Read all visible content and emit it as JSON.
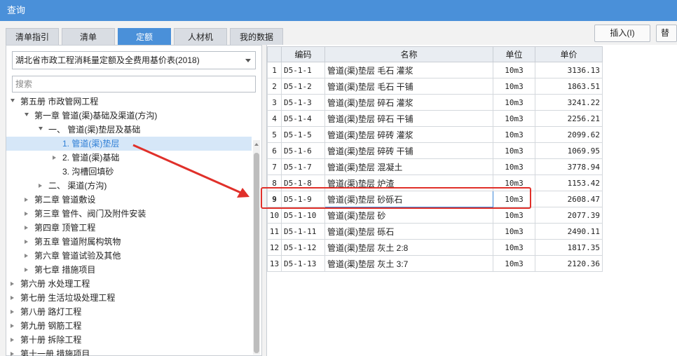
{
  "window": {
    "title": "查询"
  },
  "tabs": [
    {
      "label": "清单指引"
    },
    {
      "label": "清单"
    },
    {
      "label": "定额"
    },
    {
      "label": "人材机"
    },
    {
      "label": "我的数据"
    }
  ],
  "active_tab": "定额",
  "toolbar": {
    "insert_label": "插入(I)",
    "replace_label": "替"
  },
  "library": {
    "selected": "湖北省市政工程消耗量定额及全费用基价表(2018)"
  },
  "search": {
    "placeholder": "搜索"
  },
  "tree": [
    {
      "label": "第五册 市政管网工程",
      "state": "expanded"
    },
    {
      "label": "第一章 管道(渠)基础及渠道(方沟)",
      "state": "expanded"
    },
    {
      "label": "一、 管道(渠)垫层及基础",
      "state": "expanded"
    },
    {
      "label": "1. 管道(渠)垫层",
      "state": "leaf",
      "selected": true
    },
    {
      "label": "2. 管道(渠)基础",
      "state": "collapsed"
    },
    {
      "label": "3. 沟槽回填砂",
      "state": "leaf"
    },
    {
      "label": "二、 渠道(方沟)",
      "state": "collapsed"
    },
    {
      "label": "第二章 管道敷设",
      "state": "collapsed"
    },
    {
      "label": "第三章 管件、阀门及附件安装",
      "state": "collapsed"
    },
    {
      "label": "第四章 顶管工程",
      "state": "collapsed"
    },
    {
      "label": "第五章 管道附属构筑物",
      "state": "collapsed"
    },
    {
      "label": "第六章 管道试验及其他",
      "state": "collapsed"
    },
    {
      "label": "第七章 措施项目",
      "state": "collapsed"
    },
    {
      "label": "第六册 水处理工程",
      "state": "collapsed"
    },
    {
      "label": "第七册 生活垃圾处理工程",
      "state": "collapsed"
    },
    {
      "label": "第八册 路灯工程",
      "state": "collapsed"
    },
    {
      "label": "第九册 钢筋工程",
      "state": "collapsed"
    },
    {
      "label": "第十册 拆除工程",
      "state": "collapsed"
    },
    {
      "label": "第十一册 措施项目",
      "state": "collapsed"
    }
  ],
  "table": {
    "columns": [
      "编码",
      "名称",
      "单位",
      "单价"
    ],
    "rows": [
      {
        "idx": "1",
        "code": "D5-1-1",
        "name": "管道(渠)垫层 毛石 灌浆",
        "unit": "10m3",
        "price": "3136.13"
      },
      {
        "idx": "2",
        "code": "D5-1-2",
        "name": "管道(渠)垫层 毛石 干铺",
        "unit": "10m3",
        "price": "1863.51"
      },
      {
        "idx": "3",
        "code": "D5-1-3",
        "name": "管道(渠)垫层 碎石 灌浆",
        "unit": "10m3",
        "price": "3241.22"
      },
      {
        "idx": "4",
        "code": "D5-1-4",
        "name": "管道(渠)垫层 碎石 干铺",
        "unit": "10m3",
        "price": "2256.21"
      },
      {
        "idx": "5",
        "code": "D5-1-5",
        "name": "管道(渠)垫层 碎砖 灌浆",
        "unit": "10m3",
        "price": "2099.62"
      },
      {
        "idx": "6",
        "code": "D5-1-6",
        "name": "管道(渠)垫层 碎砖 干铺",
        "unit": "10m3",
        "price": "1069.95"
      },
      {
        "idx": "7",
        "code": "D5-1-7",
        "name": "管道(渠)垫层 混凝土",
        "unit": "10m3",
        "price": "3778.94"
      },
      {
        "idx": "8",
        "code": "D5-1-8",
        "name": "管道(渠)垫层 炉渣",
        "unit": "10m3",
        "price": "1153.42"
      },
      {
        "idx": "9",
        "code": "D5-1-9",
        "name": "管道(渠)垫层 砂砾石",
        "unit": "10m3",
        "price": "2608.47",
        "highlight": true
      },
      {
        "idx": "10",
        "code": "D5-1-10",
        "name": "管道(渠)垫层 砂",
        "unit": "10m3",
        "price": "2077.39"
      },
      {
        "idx": "11",
        "code": "D5-1-11",
        "name": "管道(渠)垫层 砾石",
        "unit": "10m3",
        "price": "2490.11"
      },
      {
        "idx": "12",
        "code": "D5-1-12",
        "name": "管道(渠)垫层 灰土 2:8",
        "unit": "10m3",
        "price": "1817.35"
      },
      {
        "idx": "13",
        "code": "D5-1-13",
        "name": "管道(渠)垫层 灰土 3:7",
        "unit": "10m3",
        "price": "2120.36"
      }
    ]
  },
  "colors": {
    "accent": "#4a90d9",
    "highlight_box": "#e0302a",
    "selected_tree_text": "#2f7fd6"
  },
  "icons": [
    "expand-arrow-icon",
    "collapse-arrow-icon",
    "dropdown-caret-icon"
  ]
}
